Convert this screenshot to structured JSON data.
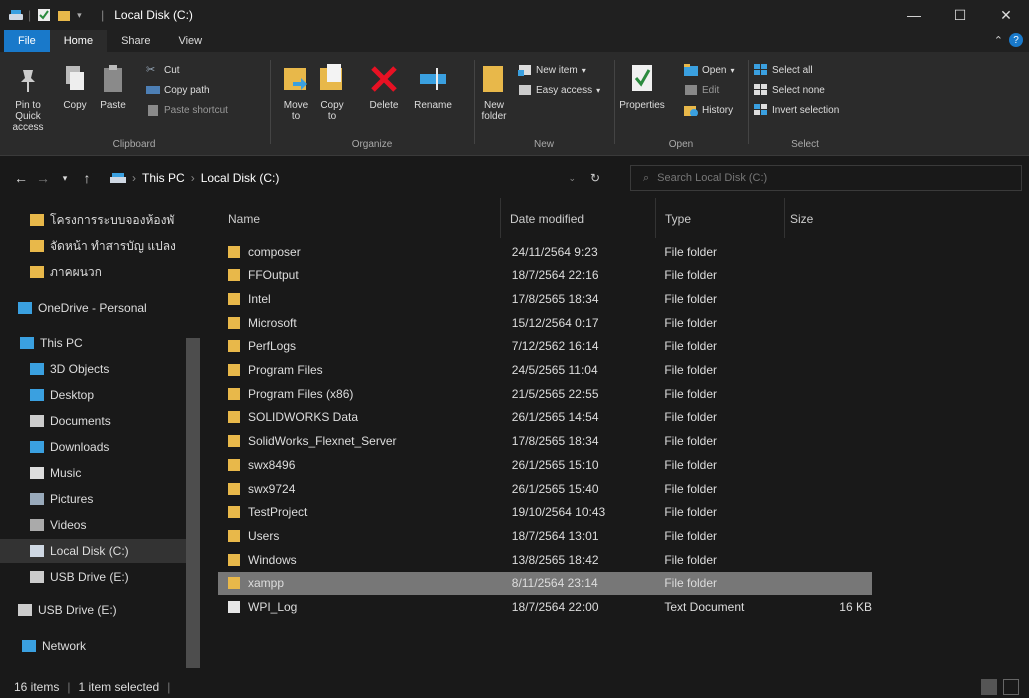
{
  "window": {
    "title": "Local Disk (C:)",
    "controls": {
      "minimize": "—",
      "maximize": "☐",
      "close": "✕"
    }
  },
  "tabs": [
    "File",
    "Home",
    "Share",
    "View"
  ],
  "ribbon": {
    "clipboard": {
      "label": "Clipboard",
      "pin": "Pin to Quick access",
      "copy": "Copy",
      "paste": "Paste",
      "cut": "Cut",
      "copy_path": "Copy path",
      "paste_shortcut": "Paste shortcut"
    },
    "organize": {
      "label": "Organize",
      "move_to": "Move to",
      "copy_to": "Copy to",
      "delete": "Delete",
      "rename": "Rename"
    },
    "new": {
      "label": "New",
      "new_folder": "New folder",
      "new_item": "New item",
      "easy_access": "Easy access"
    },
    "open": {
      "label": "Open",
      "properties": "Properties",
      "open": "Open",
      "edit": "Edit",
      "history": "History"
    },
    "select": {
      "label": "Select",
      "select_all": "Select all",
      "select_none": "Select none",
      "invert": "Invert selection"
    }
  },
  "address": {
    "path": [
      "This PC",
      "Local Disk (C:)"
    ],
    "search_placeholder": "Search Local Disk (C:)"
  },
  "nav": [
    {
      "label": "โครงการระบบจองห้องพั",
      "icon": "folder-icon"
    },
    {
      "label": "จัดหน้า ทำสารบัญ แปลง",
      "icon": "folder-icon"
    },
    {
      "label": "ภาคผนวก",
      "icon": "folder-icon"
    },
    {
      "label": "OneDrive - Personal",
      "icon": "cloud-icon"
    },
    {
      "label": "This PC",
      "icon": "pc-icon"
    },
    {
      "label": "3D Objects",
      "icon": "3d-objects-icon"
    },
    {
      "label": "Desktop",
      "icon": "desktop-icon"
    },
    {
      "label": "Documents",
      "icon": "documents-icon"
    },
    {
      "label": "Downloads",
      "icon": "downloads-icon"
    },
    {
      "label": "Music",
      "icon": "music-icon"
    },
    {
      "label": "Pictures",
      "icon": "pictures-icon"
    },
    {
      "label": "Videos",
      "icon": "videos-icon"
    },
    {
      "label": "Local Disk (C:)",
      "icon": "drive-icon"
    },
    {
      "label": "USB Drive (E:)",
      "icon": "usb-drive-icon"
    },
    {
      "label": "USB Drive (E:)",
      "icon": "usb-drive-icon"
    },
    {
      "label": "Network",
      "icon": "network-icon"
    }
  ],
  "columns": {
    "name": "Name",
    "date": "Date modified",
    "type": "Type",
    "size": "Size"
  },
  "files": [
    {
      "name": "composer",
      "date": "24/11/2564 9:23",
      "type": "File folder",
      "size": ""
    },
    {
      "name": "FFOutput",
      "date": "18/7/2564 22:16",
      "type": "File folder",
      "size": ""
    },
    {
      "name": "Intel",
      "date": "17/8/2565 18:34",
      "type": "File folder",
      "size": ""
    },
    {
      "name": "Microsoft",
      "date": "15/12/2564 0:17",
      "type": "File folder",
      "size": ""
    },
    {
      "name": "PerfLogs",
      "date": "7/12/2562 16:14",
      "type": "File folder",
      "size": ""
    },
    {
      "name": "Program Files",
      "date": "24/5/2565 11:04",
      "type": "File folder",
      "size": ""
    },
    {
      "name": "Program Files (x86)",
      "date": "21/5/2565 22:55",
      "type": "File folder",
      "size": ""
    },
    {
      "name": "SOLIDWORKS Data",
      "date": "26/1/2565 14:54",
      "type": "File folder",
      "size": ""
    },
    {
      "name": "SolidWorks_Flexnet_Server",
      "date": "17/8/2565 18:34",
      "type": "File folder",
      "size": ""
    },
    {
      "name": "swx8496",
      "date": "26/1/2565 15:10",
      "type": "File folder",
      "size": ""
    },
    {
      "name": "swx9724",
      "date": "26/1/2565 15:40",
      "type": "File folder",
      "size": ""
    },
    {
      "name": "TestProject",
      "date": "19/10/2564 10:43",
      "type": "File folder",
      "size": ""
    },
    {
      "name": "Users",
      "date": "18/7/2564 13:01",
      "type": "File folder",
      "size": ""
    },
    {
      "name": "Windows",
      "date": "13/8/2565 18:42",
      "type": "File folder",
      "size": ""
    },
    {
      "name": "xampp",
      "date": "8/11/2564 23:14",
      "type": "File folder",
      "size": ""
    },
    {
      "name": "WPI_Log",
      "date": "18/7/2564 22:00",
      "type": "Text Document",
      "size": "16 KB"
    }
  ],
  "selected_index": 14,
  "status": {
    "items": "16 items",
    "selected": "1 item selected"
  },
  "colors": {
    "accent": "#1979ca",
    "folder": "#e8b84a",
    "background": "#191919",
    "ribbon": "#2b2b2b"
  }
}
